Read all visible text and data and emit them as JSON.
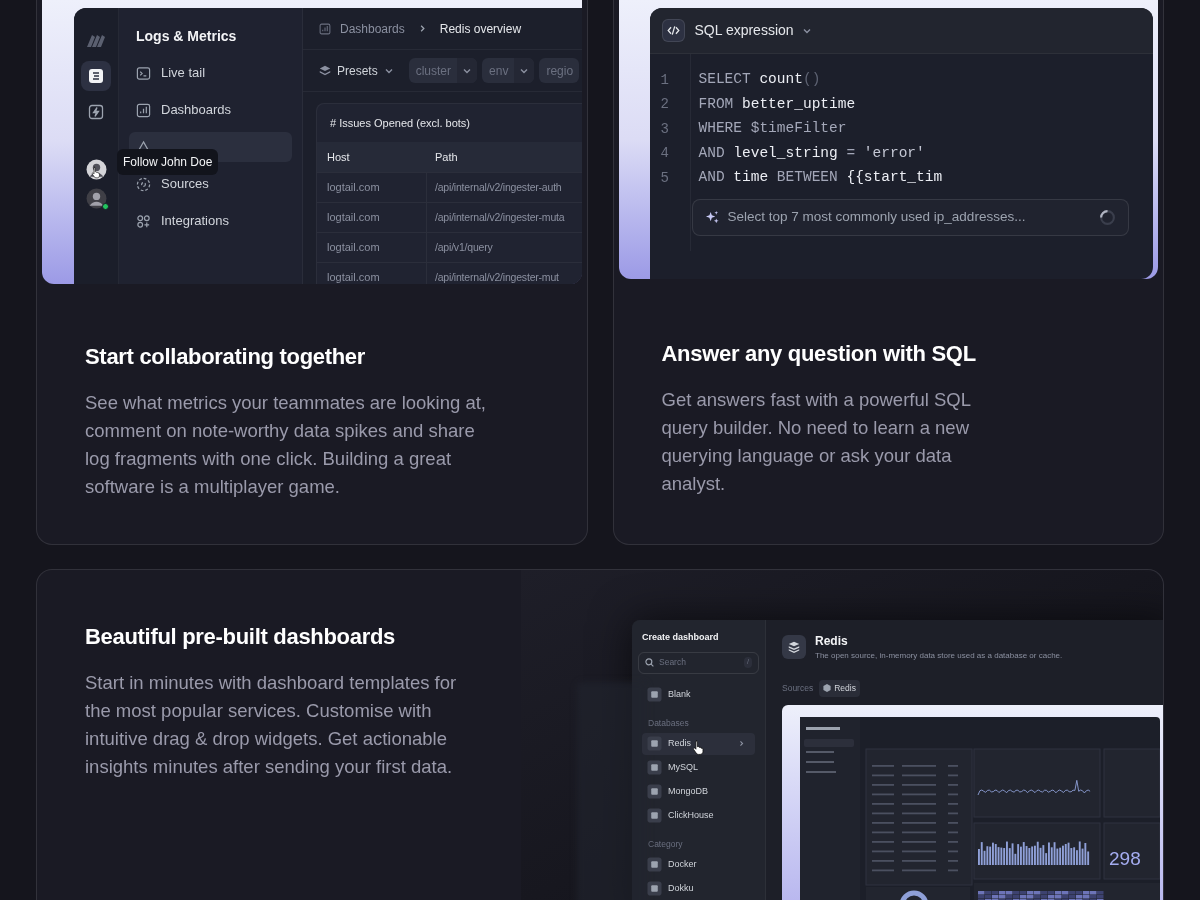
{
  "collaboration_card": {
    "app": {
      "title": "Logs & Metrics",
      "rail_items": [
        {
          "selected": true
        },
        {
          "selected": false
        }
      ],
      "avatars": [
        {
          "online": false
        },
        {
          "online": true
        }
      ],
      "tooltip": "Follow John Doe",
      "nav_items": [
        {
          "label": "Live tail",
          "selected": false
        },
        {
          "label": "Dashboards",
          "selected": false
        },
        {
          "selected": true
        },
        {
          "label": "Sources",
          "selected": false
        },
        {
          "label": "Integrations",
          "selected": false
        }
      ],
      "breadcrumb": [
        "Dashboards",
        "Redis overview"
      ],
      "presets": "Presets",
      "filters": [
        "cluster",
        "env",
        "regio"
      ],
      "table": {
        "title": "# Issues Opened (excl. bots)",
        "columns": [
          "Host",
          "Path"
        ],
        "rows": [
          [
            "logtail.com",
            "/api/internal/v2/ingester-auth"
          ],
          [
            "logtail.com",
            "/api/internal/v2/ingester-muta"
          ],
          [
            "logtail.com",
            "/api/v1/query"
          ],
          [
            "logtail.com",
            "/api/internal/v2/ingester-mut"
          ]
        ]
      }
    },
    "heading": "Start collaborating together",
    "body": "See what metrics your teammates are looking at, comment on note-worthy data spikes and share log fragments with one click. Building a great software is a multiplayer game."
  },
  "sql_card": {
    "editor": {
      "title": "SQL expression",
      "lines": [
        {
          "number": "1",
          "tokens": [
            {
              "kind": "keyword",
              "text": "SELECT "
            },
            {
              "kind": "ident",
              "text": "count"
            },
            {
              "kind": "punct",
              "text": "()"
            }
          ]
        },
        {
          "number": "2",
          "tokens": [
            {
              "kind": "keyword",
              "text": "FROM "
            },
            {
              "kind": "ident",
              "text": "better_uptime"
            }
          ]
        },
        {
          "number": "3",
          "tokens": [
            {
              "kind": "keyword",
              "text": "WHERE $timeFilter"
            }
          ]
        },
        {
          "number": "4",
          "tokens": [
            {
              "kind": "keyword",
              "text": "AND "
            },
            {
              "kind": "ident",
              "text": "level_string "
            },
            {
              "kind": "keyword",
              "text": "= "
            },
            {
              "kind": "string",
              "text": "'error'"
            }
          ]
        },
        {
          "number": "5",
          "tokens": [
            {
              "kind": "keyword",
              "text": "AND "
            },
            {
              "kind": "ident",
              "text": "time "
            },
            {
              "kind": "keyword",
              "text": "BETWEEN "
            },
            {
              "kind": "ident",
              "text": "{{start_tim"
            }
          ]
        }
      ],
      "prompt": "Select top 7 most commonly used ip_addresses..."
    },
    "heading": "Answer any question with SQL",
    "body": "Get answers fast with a powerful SQL query builder. No need to learn a new querying language or ask your data analyst."
  },
  "dashboards_card": {
    "heading": "Beautiful pre-built dashboards",
    "body": "Start in minutes with dashboard templates for the most popular services. Customise with intuitive drag & drop widgets. Get actionable insights minutes after sending your first data.",
    "panel": {
      "title": "Create dashboard",
      "search": {
        "placeholder": "Search",
        "shortcut": "/"
      },
      "groups": [
        {
          "items": [
            {
              "label": "Blank",
              "selected": false
            }
          ]
        },
        {
          "label": "Databases",
          "items": [
            {
              "label": "Redis",
              "selected": true
            },
            {
              "label": "MySQL",
              "selected": false
            },
            {
              "label": "MongoDB",
              "selected": false
            },
            {
              "label": "ClickHouse",
              "selected": false
            }
          ]
        },
        {
          "label": "Category",
          "items": [
            {
              "label": "Docker",
              "selected": false
            },
            {
              "label": "Dokku",
              "selected": false
            }
          ]
        }
      ],
      "detail": {
        "name": "Redis",
        "description": "The open source, in-memory data store used as a database or cache.",
        "sources_label": "Sources",
        "source": "Redis"
      },
      "preview_stat": "298"
    }
  }
}
